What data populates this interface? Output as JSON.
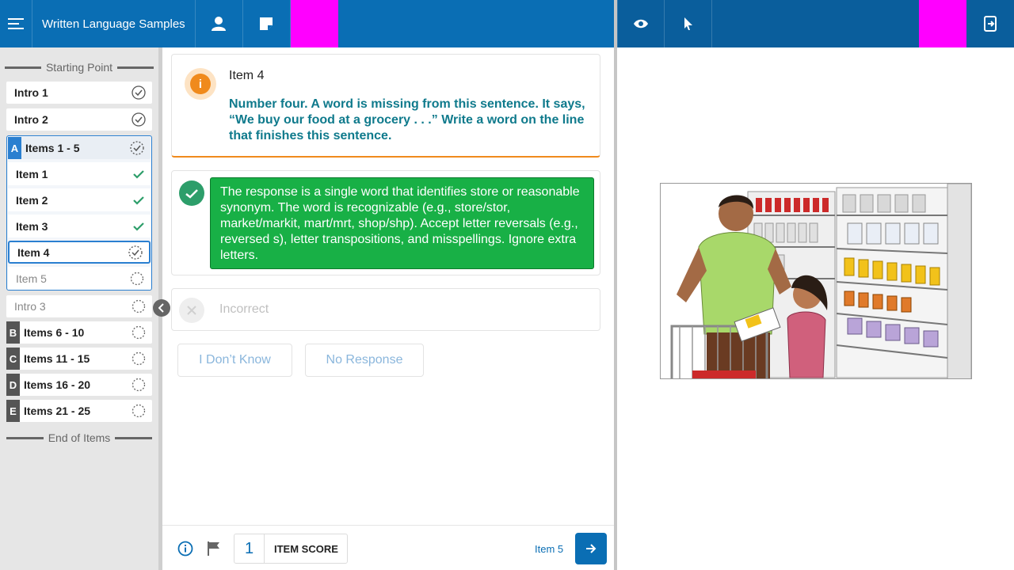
{
  "header": {
    "title": "Written Language Samples"
  },
  "sidebar": {
    "start_label": "Starting Point",
    "end_label": "End of Items",
    "items": [
      {
        "label": "Intro 1",
        "status": "complete"
      },
      {
        "label": "Intro 2",
        "status": "complete"
      }
    ],
    "active_group": {
      "letter": "A",
      "label": "Items 1 - 5",
      "sub_items": [
        {
          "label": "Item 1",
          "status": "scored"
        },
        {
          "label": "Item 2",
          "status": "scored"
        },
        {
          "label": "Item 3",
          "status": "scored"
        },
        {
          "label": "Item 4",
          "status": "in-progress"
        },
        {
          "label": "Item 5",
          "status": "not-started"
        }
      ]
    },
    "intro3": {
      "label": "Intro 3"
    },
    "groups": [
      {
        "letter": "B",
        "label": "Items 6 - 10"
      },
      {
        "letter": "C",
        "label": "Items 11 - 15"
      },
      {
        "letter": "D",
        "label": "Items 16 - 20"
      },
      {
        "letter": "E",
        "label": "Items 21 - 25"
      }
    ]
  },
  "prompt": {
    "title": "Item 4",
    "text": "Number four. A word is missing from this sentence. It says, “We buy our food at a grocery . . .” Write a word on the line that finishes this sentence."
  },
  "responses": {
    "correct_text": "The response is a single word that identifies store or reasonable synonym. The word is recognizable (e.g., store/stor, market/markit, mart/mrt, shop/shp). Accept letter reversals (e.g., reversed s), letter transpositions, and misspellings. Ignore extra letters.",
    "incorrect_label": "Incorrect",
    "dont_know_label": "I Don’t Know",
    "no_response_label": "No Response"
  },
  "footer": {
    "score_value": "1",
    "score_label": "ITEM SCORE",
    "next_label": "Item 5"
  },
  "colors": {
    "primary": "#0a6eb4",
    "correct": "#18b046",
    "accent_orange": "#f08a1c",
    "prompt_text": "#0f7a8c"
  }
}
